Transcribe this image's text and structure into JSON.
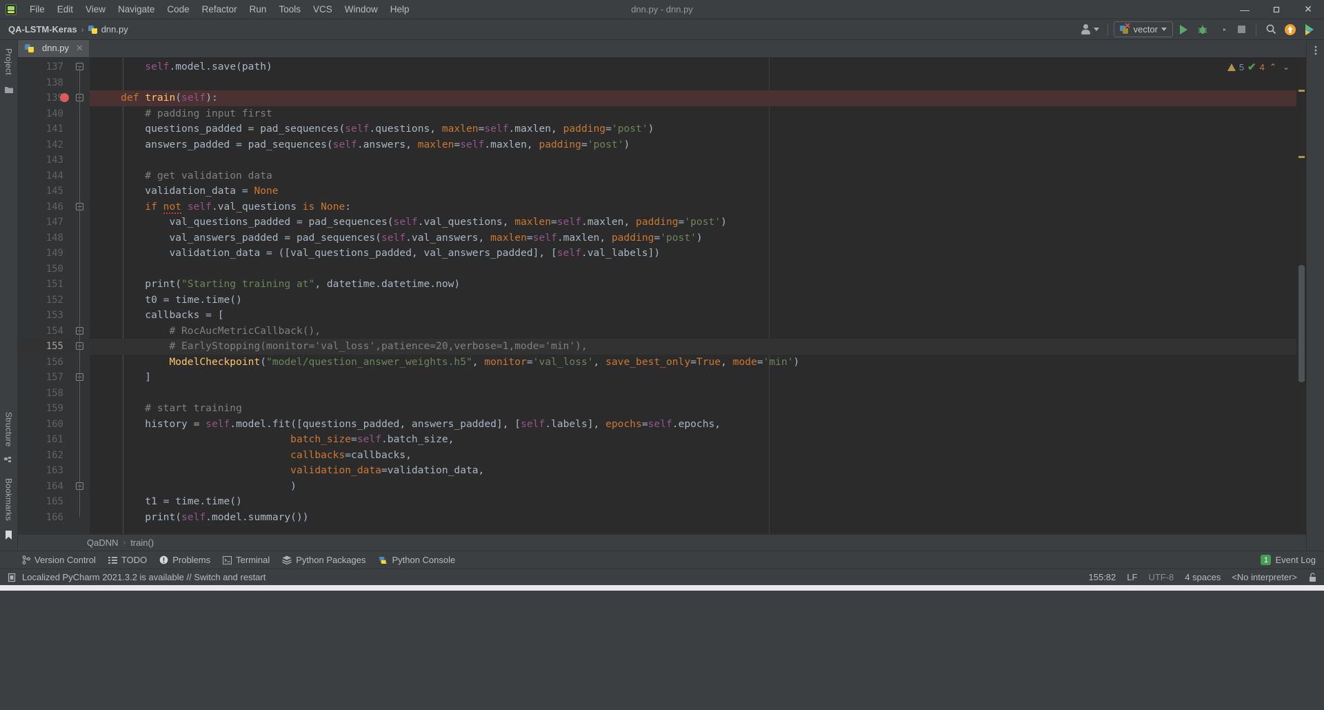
{
  "window": {
    "title": "dnn.py - dnn.py",
    "minimize_label": "—",
    "maximize_label": "❐",
    "close_label": "✕"
  },
  "menu": {
    "items": [
      {
        "label": "File"
      },
      {
        "label": "Edit"
      },
      {
        "label": "View"
      },
      {
        "label": "Navigate"
      },
      {
        "label": "Code"
      },
      {
        "label": "Refactor"
      },
      {
        "label": "Run"
      },
      {
        "label": "Tools"
      },
      {
        "label": "VCS"
      },
      {
        "label": "Window"
      },
      {
        "label": "Help"
      }
    ]
  },
  "navbar": {
    "project": "QA-LSTM-Keras",
    "separator": "›",
    "file": "dnn.py",
    "run_config": "vector",
    "icons": {
      "user": "user-icon",
      "run": "run-icon",
      "debug": "debug-icon",
      "run_coverage": "run-with-coverage-icon",
      "stop": "stop-icon",
      "search": "search-icon",
      "update": "update-icon",
      "ide_features": "ide-features-icon",
      "more": "more-options-icon"
    }
  },
  "left_strip": {
    "top_label": "Project",
    "middle_label": "Structure",
    "bottom_label": "Bookmarks"
  },
  "tabs": [
    {
      "label": "dnn.py",
      "close": "✕",
      "active": true
    }
  ],
  "inspections": {
    "warning_count": "5",
    "ok_check": "✔",
    "ok_count": "4",
    "prev": "⌃",
    "next": "⌄"
  },
  "editor": {
    "first_line": 137,
    "breakpoint_line": 139,
    "current_line": 155,
    "lines": [
      {
        "n": 137,
        "indent": 8,
        "tokens": [
          {
            "t": "self",
            "c": "self"
          },
          {
            "t": ".model.save",
            "c": "txt"
          },
          {
            "t": "(path)",
            "c": "txt"
          }
        ]
      },
      {
        "n": 138,
        "indent": 0,
        "tokens": []
      },
      {
        "n": 139,
        "indent": 4,
        "tokens": [
          {
            "t": "def ",
            "c": "kw"
          },
          {
            "t": "train",
            "c": "fn"
          },
          {
            "t": "(",
            "c": "txt"
          },
          {
            "t": "self",
            "c": "self"
          },
          {
            "t": "):",
            "c": "txt"
          }
        ]
      },
      {
        "n": 140,
        "indent": 8,
        "tokens": [
          {
            "t": "# padding input first",
            "c": "com"
          }
        ]
      },
      {
        "n": 141,
        "indent": 8,
        "tokens": [
          {
            "t": "questions_padded = pad_sequences(",
            "c": "txt"
          },
          {
            "t": "self",
            "c": "self"
          },
          {
            "t": ".questions, ",
            "c": "txt"
          },
          {
            "t": "maxlen",
            "c": "param"
          },
          {
            "t": "=",
            "c": "txt"
          },
          {
            "t": "self",
            "c": "self"
          },
          {
            "t": ".maxlen, ",
            "c": "txt"
          },
          {
            "t": "padding",
            "c": "param"
          },
          {
            "t": "=",
            "c": "txt"
          },
          {
            "t": "'post'",
            "c": "str"
          },
          {
            "t": ")",
            "c": "txt"
          }
        ]
      },
      {
        "n": 142,
        "indent": 8,
        "tokens": [
          {
            "t": "answers_padded = pad_sequences(",
            "c": "txt"
          },
          {
            "t": "self",
            "c": "self"
          },
          {
            "t": ".answers, ",
            "c": "txt"
          },
          {
            "t": "maxlen",
            "c": "param"
          },
          {
            "t": "=",
            "c": "txt"
          },
          {
            "t": "self",
            "c": "self"
          },
          {
            "t": ".maxlen, ",
            "c": "txt"
          },
          {
            "t": "padding",
            "c": "param"
          },
          {
            "t": "=",
            "c": "txt"
          },
          {
            "t": "'post'",
            "c": "str"
          },
          {
            "t": ")",
            "c": "txt"
          }
        ]
      },
      {
        "n": 143,
        "indent": 0,
        "tokens": []
      },
      {
        "n": 144,
        "indent": 8,
        "tokens": [
          {
            "t": "# get validation data",
            "c": "com"
          }
        ]
      },
      {
        "n": 145,
        "indent": 8,
        "tokens": [
          {
            "t": "validation_data = ",
            "c": "txt"
          },
          {
            "t": "None",
            "c": "kw"
          }
        ]
      },
      {
        "n": 146,
        "indent": 8,
        "tokens": [
          {
            "t": "if ",
            "c": "kw"
          },
          {
            "t": "not",
            "c": "kw"
          },
          {
            "t": " ",
            "c": "txt"
          },
          {
            "t": "self",
            "c": "self"
          },
          {
            "t": ".val_questions ",
            "c": "txt"
          },
          {
            "t": "is ",
            "c": "kw"
          },
          {
            "t": "None",
            "c": "kw"
          },
          {
            "t": ":",
            "c": "txt"
          }
        ]
      },
      {
        "n": 147,
        "indent": 12,
        "tokens": [
          {
            "t": "val_questions_padded = pad_sequences(",
            "c": "txt"
          },
          {
            "t": "self",
            "c": "self"
          },
          {
            "t": ".val_questions, ",
            "c": "txt"
          },
          {
            "t": "maxlen",
            "c": "param"
          },
          {
            "t": "=",
            "c": "txt"
          },
          {
            "t": "self",
            "c": "self"
          },
          {
            "t": ".maxlen, ",
            "c": "txt"
          },
          {
            "t": "padding",
            "c": "param"
          },
          {
            "t": "=",
            "c": "txt"
          },
          {
            "t": "'post'",
            "c": "str"
          },
          {
            "t": ")",
            "c": "txt"
          }
        ]
      },
      {
        "n": 148,
        "indent": 12,
        "tokens": [
          {
            "t": "val_answers_padded = pad_sequences(",
            "c": "txt"
          },
          {
            "t": "self",
            "c": "self"
          },
          {
            "t": ".val_answers, ",
            "c": "txt"
          },
          {
            "t": "maxlen",
            "c": "param"
          },
          {
            "t": "=",
            "c": "txt"
          },
          {
            "t": "self",
            "c": "self"
          },
          {
            "t": ".maxlen, ",
            "c": "txt"
          },
          {
            "t": "padding",
            "c": "param"
          },
          {
            "t": "=",
            "c": "txt"
          },
          {
            "t": "'post'",
            "c": "str"
          },
          {
            "t": ")",
            "c": "txt"
          }
        ]
      },
      {
        "n": 149,
        "indent": 12,
        "tokens": [
          {
            "t": "validation_data = ([val_questions_padded, val_answers_padded], [",
            "c": "txt"
          },
          {
            "t": "self",
            "c": "self"
          },
          {
            "t": ".val_labels])",
            "c": "txt"
          }
        ]
      },
      {
        "n": 150,
        "indent": 0,
        "tokens": []
      },
      {
        "n": 151,
        "indent": 8,
        "tokens": [
          {
            "t": "print(",
            "c": "txt"
          },
          {
            "t": "\"Starting training at\"",
            "c": "str"
          },
          {
            "t": ", datetime.datetime.now)",
            "c": "txt"
          }
        ]
      },
      {
        "n": 152,
        "indent": 8,
        "tokens": [
          {
            "t": "t0 = time.time()",
            "c": "txt"
          }
        ]
      },
      {
        "n": 153,
        "indent": 8,
        "tokens": [
          {
            "t": "callbacks = [",
            "c": "txt"
          }
        ]
      },
      {
        "n": 154,
        "indent": 12,
        "tokens": [
          {
            "t": "# RocAucMetricCallback(),",
            "c": "com"
          }
        ]
      },
      {
        "n": 155,
        "indent": 12,
        "tokens": [
          {
            "t": "# EarlyStopping(monitor='val_loss',patience=20,verbose=1,mode='min'),",
            "c": "com"
          }
        ]
      },
      {
        "n": 156,
        "indent": 12,
        "tokens": [
          {
            "t": "ModelCheckpoint",
            "c": "fn"
          },
          {
            "t": "(",
            "c": "txt"
          },
          {
            "t": "\"model/question_answer_weights.h5\"",
            "c": "str"
          },
          {
            "t": ", ",
            "c": "txt"
          },
          {
            "t": "monitor",
            "c": "param"
          },
          {
            "t": "=",
            "c": "txt"
          },
          {
            "t": "'val_loss'",
            "c": "str"
          },
          {
            "t": ", ",
            "c": "txt"
          },
          {
            "t": "save_best_only",
            "c": "param"
          },
          {
            "t": "=",
            "c": "txt"
          },
          {
            "t": "True",
            "c": "kw"
          },
          {
            "t": ", ",
            "c": "txt"
          },
          {
            "t": "mode",
            "c": "param"
          },
          {
            "t": "=",
            "c": "txt"
          },
          {
            "t": "'min'",
            "c": "str"
          },
          {
            "t": ")",
            "c": "txt"
          }
        ]
      },
      {
        "n": 157,
        "indent": 8,
        "tokens": [
          {
            "t": "]",
            "c": "txt"
          }
        ]
      },
      {
        "n": 158,
        "indent": 0,
        "tokens": []
      },
      {
        "n": 159,
        "indent": 8,
        "tokens": [
          {
            "t": "# start training",
            "c": "com"
          }
        ]
      },
      {
        "n": 160,
        "indent": 8,
        "tokens": [
          {
            "t": "history = ",
            "c": "txt"
          },
          {
            "t": "self",
            "c": "self"
          },
          {
            "t": ".model.fit([questions_padded, answers_padded], [",
            "c": "txt"
          },
          {
            "t": "self",
            "c": "self"
          },
          {
            "t": ".labels], ",
            "c": "txt"
          },
          {
            "t": "epochs",
            "c": "param"
          },
          {
            "t": "=",
            "c": "txt"
          },
          {
            "t": "self",
            "c": "self"
          },
          {
            "t": ".epochs,",
            "c": "txt"
          }
        ]
      },
      {
        "n": 161,
        "indent": 32,
        "tokens": [
          {
            "t": "batch_size",
            "c": "param"
          },
          {
            "t": "=",
            "c": "txt"
          },
          {
            "t": "self",
            "c": "self"
          },
          {
            "t": ".batch_size,",
            "c": "txt"
          }
        ]
      },
      {
        "n": 162,
        "indent": 32,
        "tokens": [
          {
            "t": "callbacks",
            "c": "param"
          },
          {
            "t": "=callbacks,",
            "c": "txt"
          }
        ]
      },
      {
        "n": 163,
        "indent": 32,
        "tokens": [
          {
            "t": "validation_data",
            "c": "param"
          },
          {
            "t": "=validation_data,",
            "c": "txt"
          }
        ]
      },
      {
        "n": 164,
        "indent": 32,
        "tokens": [
          {
            "t": ")",
            "c": "txt"
          }
        ]
      },
      {
        "n": 165,
        "indent": 8,
        "tokens": [
          {
            "t": "t1 = time.time()",
            "c": "txt"
          }
        ]
      },
      {
        "n": 166,
        "indent": 8,
        "tokens": [
          {
            "t": "print(",
            "c": "txt"
          },
          {
            "t": "self",
            "c": "self"
          },
          {
            "t": ".model.summary())",
            "c": "txt"
          }
        ]
      }
    ]
  },
  "editor_breadcrumb": {
    "class_name": "QaDNN",
    "separator": "›",
    "method_name": "train()"
  },
  "tool_windows": [
    {
      "label": "Version Control",
      "icon": "branch-icon"
    },
    {
      "label": "TODO",
      "icon": "list-icon"
    },
    {
      "label": "Problems",
      "icon": "problems-icon"
    },
    {
      "label": "Terminal",
      "icon": "terminal-icon"
    },
    {
      "label": "Python Packages",
      "icon": "packages-icon"
    },
    {
      "label": "Python Console",
      "icon": "python-console-icon"
    }
  ],
  "event_log": {
    "count": "1",
    "label": "Event Log"
  },
  "statusbar": {
    "message": "Localized PyCharm 2021.3.2 is available // Switch and restart",
    "caret_position": "155:82",
    "line_separator": "LF",
    "encoding": "UTF-8",
    "indent": "4 spaces",
    "interpreter": "<No interpreter>",
    "lock_icon": "unlocked-icon"
  },
  "colors": {
    "accent_green": "#59a869",
    "breakpoint_red": "#db5c5c",
    "warning_amber": "#b3954a",
    "string_green": "#6a8759",
    "keyword_orange": "#cc7832",
    "self_purple": "#94558d",
    "function_yellow": "#ffc66d",
    "number_blue": "#6897bb",
    "editor_bg": "#2b2b2b",
    "panel_bg": "#3c3f41"
  }
}
